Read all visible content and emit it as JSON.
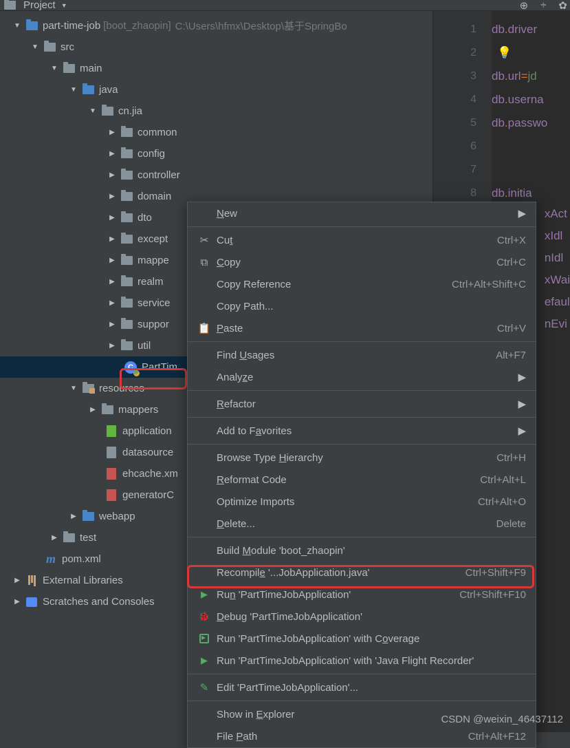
{
  "toolbar": {
    "project_label": "Project"
  },
  "project": {
    "root": "part-time-job",
    "root_bracket": "[boot_zhaopin]",
    "root_path": "C:\\Users\\hfmx\\Desktop\\基于SpringBo",
    "src": "src",
    "main": "main",
    "java": "java",
    "cnjia": "cn.jia",
    "common": "common",
    "config": "config",
    "controller": "controller",
    "domain": "domain",
    "dto": "dto",
    "except": "except",
    "mapper": "mappe",
    "realm": "realm",
    "service": "service",
    "support": "suppor",
    "util": "util",
    "selected": "PartTim",
    "resources": "resources",
    "mappers": "mappers",
    "application": "application",
    "datasource": "datasource",
    "ehcache": "ehcache.xm",
    "generator": "generatorC",
    "webapp": "webapp",
    "test": "test",
    "pom": "pom.xml",
    "external": "External Libraries",
    "scratches": "Scratches and Consoles"
  },
  "menu": {
    "new": "New",
    "cut": "Cut",
    "cut_sc": "Ctrl+X",
    "copy": "Copy",
    "copy_sc": "Ctrl+C",
    "copyref": "Copy Reference",
    "copyref_sc": "Ctrl+Alt+Shift+C",
    "copypath": "Copy Path...",
    "paste": "Paste",
    "paste_sc": "Ctrl+V",
    "findusages": "Find Usages",
    "findusages_sc": "Alt+F7",
    "analyze": "Analyze",
    "refactor": "Refactor",
    "favorites": "Add to Favorites",
    "browse": "Browse Type Hierarchy",
    "browse_sc": "Ctrl+H",
    "reformat": "Reformat Code",
    "reformat_sc": "Ctrl+Alt+L",
    "optimize": "Optimize Imports",
    "optimize_sc": "Ctrl+Alt+O",
    "delete": "Delete...",
    "delete_sc": "Delete",
    "build": "Build Module 'boot_zhaopin'",
    "recompile": "Recompile '...JobApplication.java'",
    "recompile_sc": "Ctrl+Shift+F9",
    "run": "Run 'PartTimeJobApplication'",
    "run_sc": "Ctrl+Shift+F10",
    "debug": "Debug 'PartTimeJobApplication'",
    "coverage": "Run 'PartTimeJobApplication' with Coverage",
    "flight": "Run 'PartTimeJobApplication' with 'Java Flight Recorder'",
    "edit": "Edit 'PartTimeJobApplication'...",
    "explorer": "Show in Explorer",
    "filepath": "File Path",
    "filepath_sc": "Ctrl+Alt+F12"
  },
  "code": {
    "l1a": "db",
    "l1b": ".",
    "l1c": "driver",
    "l3a": "db",
    "l3b": ".",
    "l3c": "url",
    "l3d": "=",
    "l3e": "jd",
    "l4a": "db",
    "l4b": ".",
    "l4c": "userna",
    "l5a": "db",
    "l5b": ".",
    "l5c": "passwo",
    "l8a": "db",
    "l8b": ".",
    "l8c": "initia",
    "r9": "xAct",
    "r10": "xIdl",
    "r11": "nIdl",
    "r12": "xWai",
    "r13": "efaul",
    "r14": "nEvi"
  },
  "watermark": "CSDN @weixin_46437112"
}
